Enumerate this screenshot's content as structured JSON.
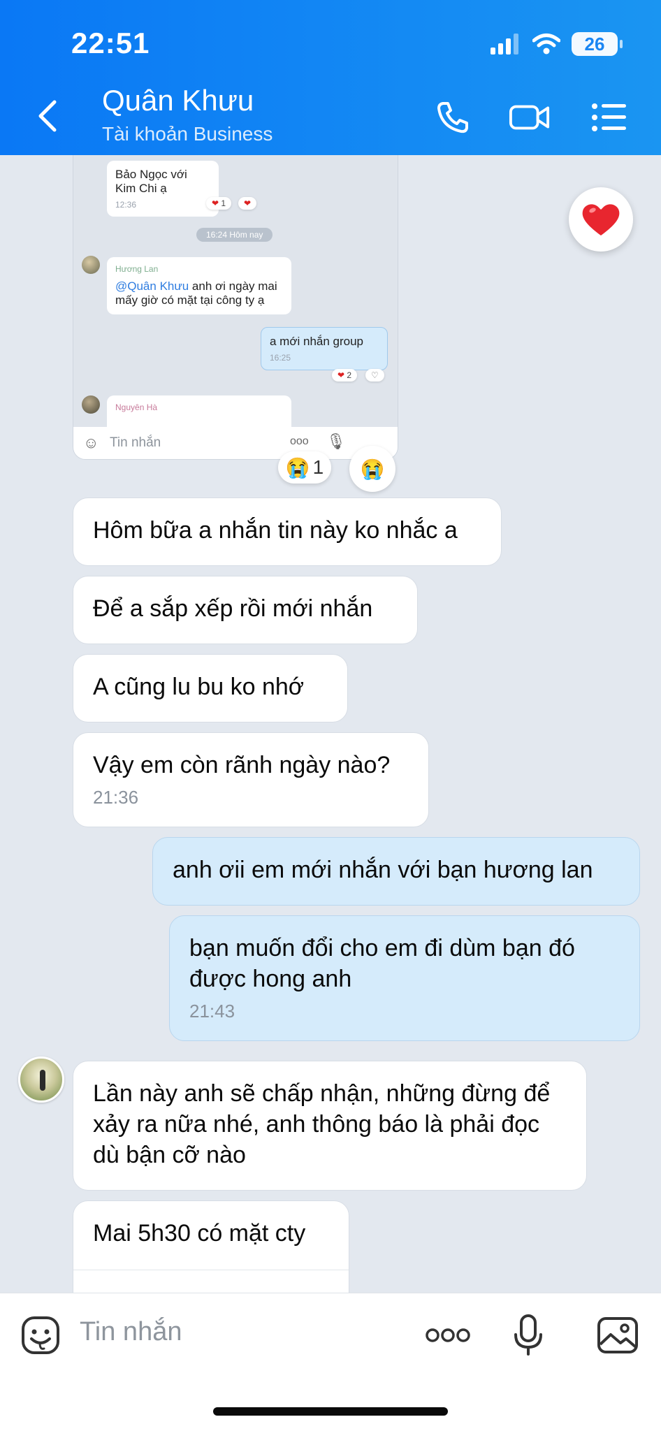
{
  "status": {
    "time": "22:51",
    "battery": "26"
  },
  "header": {
    "name": "Quân Khưu",
    "subtitle": "Tài khoản Business"
  },
  "embedded": {
    "bubble1": {
      "text": "Bảo Ngọc với Kim Chi ạ",
      "time": "12:36",
      "reaction": "1"
    },
    "divider": "16:24 Hôm nay",
    "bubble2": {
      "sender": "Hương Lan",
      "mention": "@Quân Khưu",
      "text": " anh ơi ngày mai mấy giờ có mặt tại công ty ạ"
    },
    "bubble3": {
      "text": "a mới nhắn group",
      "time": "16:25",
      "reaction": "2"
    },
    "bubble4": {
      "sender": "Nguyên Hà"
    },
    "input_placeholder": "Tin nhắn"
  },
  "reactions": {
    "count": "1"
  },
  "messages": [
    {
      "dir": "in",
      "text": "Hôm bữa a nhắn tin này ko nhắc a"
    },
    {
      "dir": "in",
      "text": "Để a sắp xếp rồi mới nhắn"
    },
    {
      "dir": "in",
      "text": "A cũng lu bu ko nhớ"
    },
    {
      "dir": "in",
      "text": "Vậy em còn rãnh ngày nào?",
      "time": "21:36"
    },
    {
      "dir": "out",
      "text": "anh ơii em mới nhắn với bạn hương lan"
    },
    {
      "dir": "out",
      "text": "bạn muốn đổi cho em đi dùm bạn đó được hong anh",
      "time": "21:43"
    },
    {
      "dir": "in",
      "text": "Lần này anh sẽ chấp nhận, những đừng để xảy ra nữa nhé, anh thông báo là phải đọc dù bận cỡ nào"
    },
    {
      "dir": "in",
      "text": "Mai 5h30 có mặt cty"
    }
  ],
  "input": {
    "placeholder": "Tin nhắn"
  },
  "colors": {
    "header": "#0a78f5",
    "bubble_out": "#d5ebfb",
    "bubble_in": "#ffffff",
    "background": "#e3e8ef"
  },
  "icons": [
    "back-icon",
    "phone-icon",
    "video-icon",
    "menu-icon",
    "heart-icon",
    "sticker-icon",
    "more-icon",
    "mic-icon",
    "image-icon"
  ]
}
